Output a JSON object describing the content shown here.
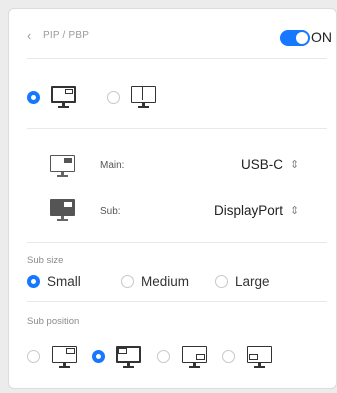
{
  "header": {
    "breadcrumb": "PIP / PBP",
    "toggle_label": "ON",
    "toggle_on": true
  },
  "modes": [
    {
      "name": "PIP",
      "selected": true
    },
    {
      "name": "PBP",
      "selected": false
    }
  ],
  "sources": {
    "main": {
      "label": "Main:",
      "value": "USB-C"
    },
    "sub": {
      "label": "Sub:",
      "value": "DisplayPort"
    }
  },
  "sub_size": {
    "label": "Sub size",
    "options": [
      {
        "label": "Small",
        "selected": true
      },
      {
        "label": "Medium",
        "selected": false
      },
      {
        "label": "Large",
        "selected": false
      }
    ]
  },
  "sub_position": {
    "label": "Sub position",
    "options": [
      {
        "name": "top-right",
        "selected": false
      },
      {
        "name": "top-left",
        "selected": true
      },
      {
        "name": "bottom-right",
        "selected": false
      },
      {
        "name": "bottom-left",
        "selected": false
      }
    ]
  },
  "colors": {
    "accent": "#1677ff",
    "icon_main": "#555555",
    "icon_sub": "#555555"
  }
}
